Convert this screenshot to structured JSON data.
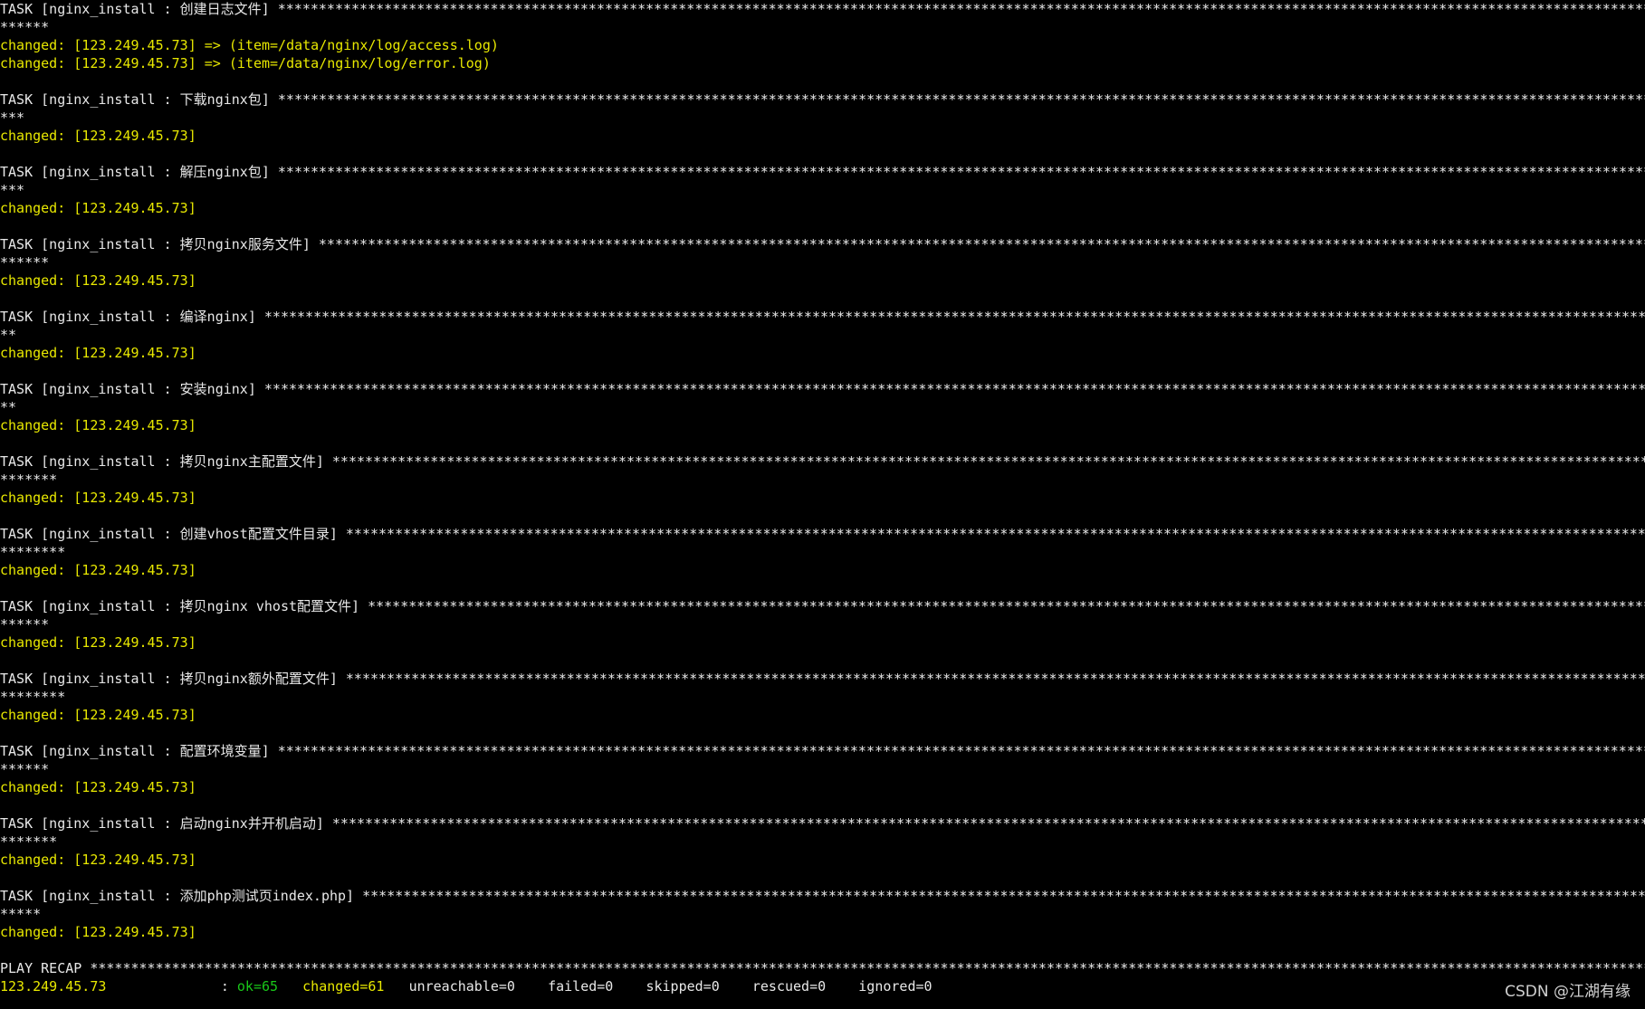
{
  "tasks": [
    {
      "title": "TASK [nginx_install : 创建日志文件] ",
      "cont": "******",
      "results": [
        "changed: [123.249.45.73] => (item=/data/nginx/log/access.log)",
        "changed: [123.249.45.73] => (item=/data/nginx/log/error.log)"
      ]
    },
    {
      "title": "TASK [nginx_install : 下载nginx包] ",
      "cont": "***",
      "results": [
        "changed: [123.249.45.73]"
      ]
    },
    {
      "title": "TASK [nginx_install : 解压nginx包] ",
      "cont": "***",
      "results": [
        "changed: [123.249.45.73]"
      ]
    },
    {
      "title": "TASK [nginx_install : 拷贝nginx服务文件] ",
      "cont": "******",
      "results": [
        "changed: [123.249.45.73]"
      ]
    },
    {
      "title": "TASK [nginx_install : 编译nginx] ",
      "cont": "**",
      "results": [
        "changed: [123.249.45.73]"
      ]
    },
    {
      "title": "TASK [nginx_install : 安装nginx] ",
      "cont": "**",
      "results": [
        "changed: [123.249.45.73]"
      ]
    },
    {
      "title": "TASK [nginx_install : 拷贝nginx主配置文件] ",
      "cont": "*******",
      "results": [
        "changed: [123.249.45.73]"
      ]
    },
    {
      "title": "TASK [nginx_install : 创建vhost配置文件目录] ",
      "cont": "********",
      "results": [
        "changed: [123.249.45.73]"
      ]
    },
    {
      "title": "TASK [nginx_install : 拷贝nginx vhost配置文件] ",
      "cont": "******",
      "results": [
        "changed: [123.249.45.73]"
      ]
    },
    {
      "title": "TASK [nginx_install : 拷贝nginx额外配置文件] ",
      "cont": "********",
      "results": [
        "changed: [123.249.45.73]"
      ]
    },
    {
      "title": "TASK [nginx_install : 配置环境变量] ",
      "cont": "******",
      "results": [
        "changed: [123.249.45.73]"
      ]
    },
    {
      "title": "TASK [nginx_install : 启动nginx并开机启动] ",
      "cont": "*******",
      "results": [
        "changed: [123.249.45.73]"
      ]
    },
    {
      "title": "TASK [nginx_install : 添加php测试页index.php] ",
      "cont": "*****",
      "results": [
        "changed: [123.249.45.73]"
      ]
    }
  ],
  "recap": {
    "title": "PLAY RECAP ",
    "host": "123.249.45.73",
    "sep": "              : ",
    "ok": "ok=65",
    "changed": "changed=61",
    "unreachable": "unreachable=0",
    "failed": "failed=0",
    "skipped": "skipped=0",
    "rescued": "rescued=0",
    "ignored": "ignored=0"
  },
  "watermark": "CSDN @江湖有缘",
  "colors": {
    "background": "#000000",
    "header_text": "#e8e8e8",
    "changed_text": "#e8e800",
    "ok_text": "#19c819"
  }
}
